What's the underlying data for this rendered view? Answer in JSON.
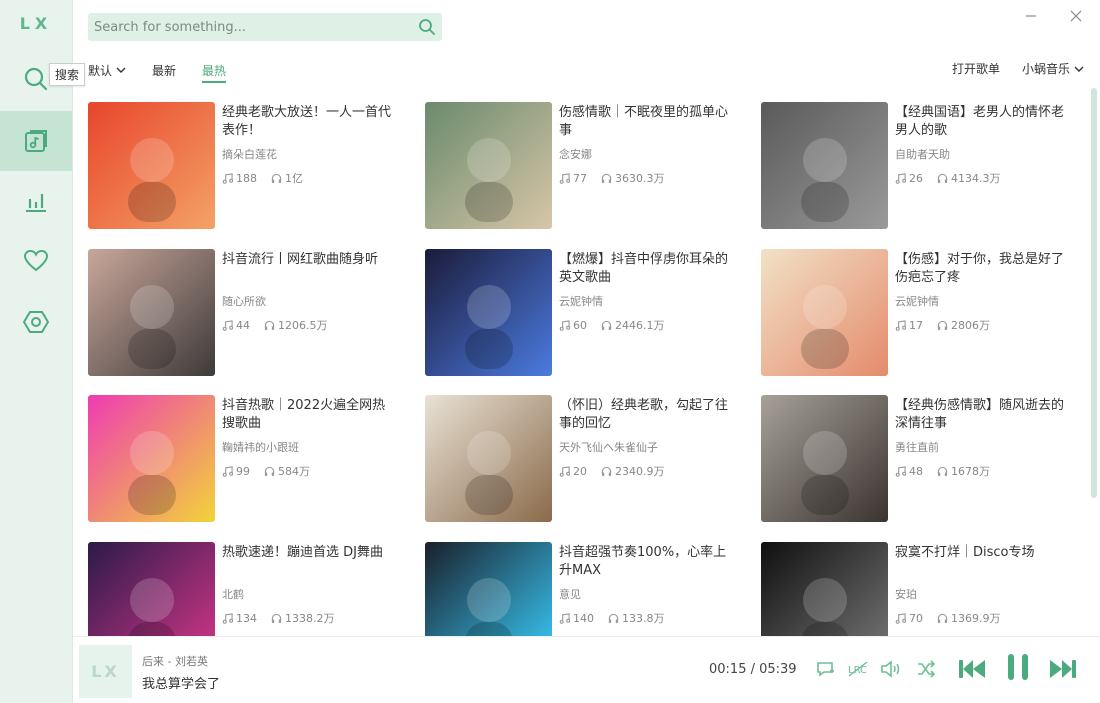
{
  "app": {
    "logo": "LX"
  },
  "sidebar": {
    "tooltip": "搜索",
    "items": [
      {
        "icon": "search-icon"
      },
      {
        "icon": "songlist-icon",
        "active": true
      },
      {
        "icon": "leaderboard-icon"
      },
      {
        "icon": "heart-icon"
      },
      {
        "icon": "settings-icon"
      }
    ]
  },
  "search": {
    "placeholder": "Search for something..."
  },
  "tabs": [
    {
      "label": "默认",
      "dropdown": true
    },
    {
      "label": "最新"
    },
    {
      "label": "最热",
      "active": true
    }
  ],
  "actions": {
    "open_playlist": "打开歌单",
    "source": "小蜗音乐"
  },
  "playlists": [
    {
      "title": "经典老歌大放送！一人一首代表作！",
      "author": "摘朵白莲花",
      "songs": "188",
      "plays": "1亿"
    },
    {
      "title": "伤感情歌｜不眠夜里的孤单心事",
      "author": "念安娜",
      "songs": "77",
      "plays": "3630.3万"
    },
    {
      "title": "【经典国语】老男人的情怀老男人的歌",
      "author": "自助者天助",
      "songs": "26",
      "plays": "4134.3万"
    },
    {
      "title": "抖音流行丨网红歌曲随身听",
      "author": "随心所欲",
      "songs": "44",
      "plays": "1206.5万"
    },
    {
      "title": "【燃爆】抖音中俘虏你耳朵的英文歌曲",
      "author": "云妮钟情",
      "songs": "60",
      "plays": "2446.1万"
    },
    {
      "title": "【伤感】对于你，我总是好了伤疤忘了疼",
      "author": "云妮钟情",
      "songs": "17",
      "plays": "2806万"
    },
    {
      "title": "抖音热歌｜2022火遍全网热搜歌曲",
      "author": "鞠婧祎的小跟班",
      "songs": "99",
      "plays": "584万"
    },
    {
      "title": "（怀旧）经典老歌，勾起了往事的回忆",
      "author": "天外飞仙ヘ朱雀仙子",
      "songs": "20",
      "plays": "2340.9万"
    },
    {
      "title": "【经典伤感情歌】随风逝去的深情往事",
      "author": "勇往直前",
      "songs": "48",
      "plays": "1678万"
    },
    {
      "title": "热歌速递！蹦迪首选 DJ舞曲",
      "author": "北鹤",
      "songs": "134",
      "plays": "1338.2万"
    },
    {
      "title": "抖音超强节奏100%，心率上升MAX",
      "author": "意见",
      "songs": "140",
      "plays": "133.8万"
    },
    {
      "title": "寂寞不打烊｜Disco专场",
      "author": "安珀",
      "songs": "70",
      "plays": "1369.9万"
    }
  ],
  "player": {
    "cover_text": "LX",
    "artist": "后来 - 刘若英",
    "lyric": "我总算学会了",
    "time": "00:15 / 05:39"
  },
  "colors": {
    "accent": "#4cab7e",
    "sidebar_bg": "#e8f3ee",
    "search_bg": "#dff0e7"
  }
}
